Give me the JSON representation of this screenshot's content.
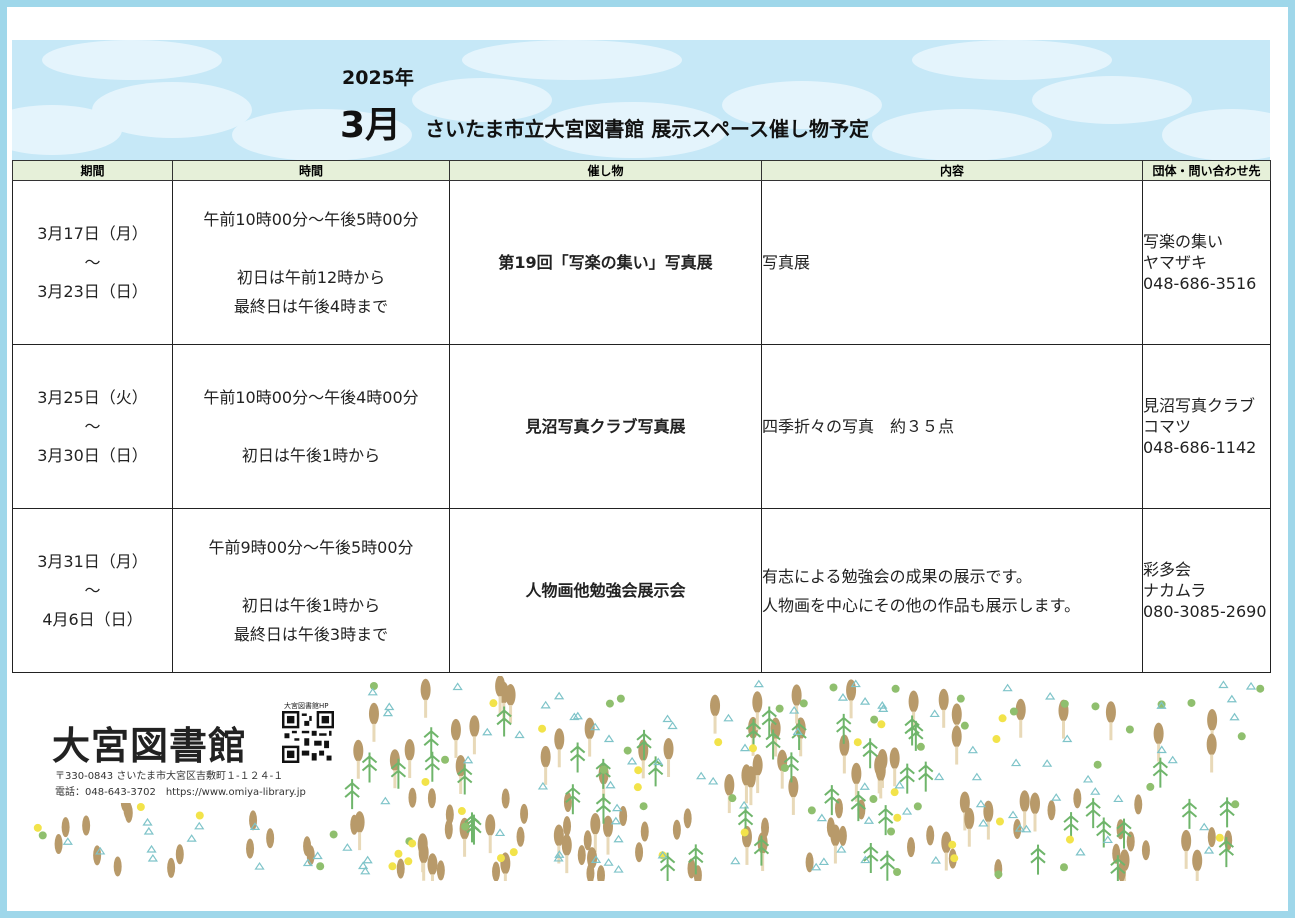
{
  "header": {
    "year": "2025年",
    "month": "3月",
    "title": "さいたま市立大宮図書館 展示スペース催し物予定"
  },
  "table": {
    "columns": [
      "期間",
      "時間",
      "催し物",
      "内容",
      "団体・問い合わせ先"
    ],
    "rows": [
      {
        "period": [
          "3月17日（月）",
          "～",
          "3月23日（日）"
        ],
        "time": [
          "午前10時00分～午後5時00分",
          "",
          "初日は午前12時から",
          "最終日は午後4時まで"
        ],
        "event": "第19回「写楽の集い」写真展",
        "content": [
          "写真展"
        ],
        "contact": [
          "写楽の集い",
          "ヤマザキ",
          "048-686-3516"
        ]
      },
      {
        "period": [
          "3月25日（火）",
          "～",
          "3月30日（日）"
        ],
        "time": [
          "午前10時00分～午後4時00分",
          "",
          "初日は午後1時から"
        ],
        "event": "見沼写真クラブ写真展",
        "content": [
          "四季折々の写真　約３５点"
        ],
        "contact": [
          "見沼写真クラブ",
          "コマツ",
          "048-686-1142"
        ]
      },
      {
        "period": [
          "3月31日（月）",
          "～",
          "4月6日（日）"
        ],
        "time": [
          "午前9時00分～午後5時00分",
          "",
          "初日は午後1時から",
          "最終日は午後3時まで"
        ],
        "event": "人物画他勉強会展示会",
        "content": [
          "有志による勉強会の成果の展示です。",
          "人物画を中心にその他の作品も展示します。"
        ],
        "contact": [
          "彩多会",
          "ナカムラ",
          "080-3085-2690"
        ]
      }
    ]
  },
  "footer": {
    "logo": "大宮図書館",
    "qr_label": "大宮図書館HP",
    "address": "〒330-0843 さいたま市大宮区吉敷町１-１２４-１",
    "tel": "電話：048-643-3702　https://www.omiya-library.jp"
  },
  "colors": {
    "frame": "#9fd7ea",
    "sky": "#c6e8f7",
    "header_row": "#e6f0d9",
    "logo_green": "#2f9a4a",
    "logo_red": "#d9342b"
  }
}
